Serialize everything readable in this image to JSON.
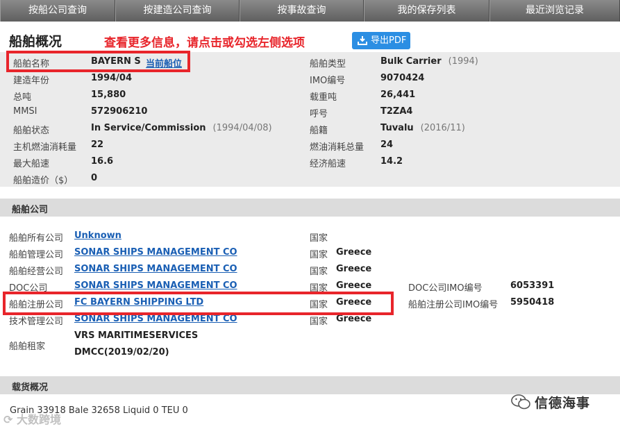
{
  "nav": [
    "按船公司查询",
    "按建造公司查询",
    "按事故查询",
    "我的保存列表",
    "最近浏览记录"
  ],
  "page_title": "船舶概况",
  "hint": "查看更多信息，请点击或勾选左侧选项",
  "export_pdf": "导出PDF",
  "overview": {
    "name_label": "船舶名称",
    "name_value": "BAYERN S",
    "position_link": "当前船位",
    "type_label": "船舶类型",
    "type_value": "Bulk Carrier",
    "type_year": "(1994)",
    "built_label": "建造年份",
    "built_value": "1994/04",
    "imo_label": "IMO编号",
    "imo_value": "9070424",
    "gt_label": "总吨",
    "gt_value": "15,880",
    "dwt_label": "载重吨",
    "dwt_value": "26,441",
    "mmsi_label": "MMSI",
    "mmsi_value": "572906210",
    "call_label": "呼号",
    "call_value": "T2ZA4",
    "status_label": "船舶状态",
    "status_value": "In Service/Commission",
    "status_date": "(1994/04/08)",
    "flag_label": "船籍",
    "flag_value": "Tuvalu",
    "flag_date": "(2016/11)",
    "main_fuel_label": "主机燃油消耗量",
    "main_fuel_value": "22",
    "total_fuel_label": "燃油消耗总量",
    "total_fuel_value": "24",
    "max_speed_label": "最大船速",
    "max_speed_value": "16.6",
    "eco_speed_label": "经济船速",
    "eco_speed_value": "14.2",
    "price_label": "船舶造价（$）",
    "price_value": "0"
  },
  "company_section": "船舶公司",
  "companies": {
    "owner_label": "船舶所有公司",
    "owner_value": "Unknown",
    "manager_label": "船舶管理公司",
    "manager_value": "SONAR SHIPS MANAGEMENT CO",
    "operator_label": "船舶经营公司",
    "operator_value": "SONAR SHIPS MANAGEMENT CO",
    "doc_label": "DOC公司",
    "doc_value": "SONAR SHIPS MANAGEMENT CO",
    "reg_label": "船舶注册公司",
    "reg_value": "FC BAYERN SHIPPING LTD",
    "tech_label": "技术管理公司",
    "tech_value": "SONAR SHIPS MANAGEMENT CO",
    "charter_label": "船舶租家",
    "charter_value_1": "VRS MARITIMESERVICES",
    "charter_value_2": "DMCC(2019/02/20)",
    "country_label": "国家",
    "country_greece": "Greece",
    "doc_imo_label": "DOC公司IMO编号",
    "doc_imo_value": "6053391",
    "reg_imo_label": "船舶注册公司IMO编号",
    "reg_imo_value": "5950418"
  },
  "cargo_section": "载货概况",
  "cargo_text": "Grain 33918 Bale 32658 Liquid 0 TEU 0",
  "watermark": "信德海事",
  "watermark2": "大数跨境",
  "colors": {
    "highlight": "#e8252b",
    "link": "#1a5fb4",
    "button": "#2b8ee3",
    "nav": "#6e6e6e"
  }
}
